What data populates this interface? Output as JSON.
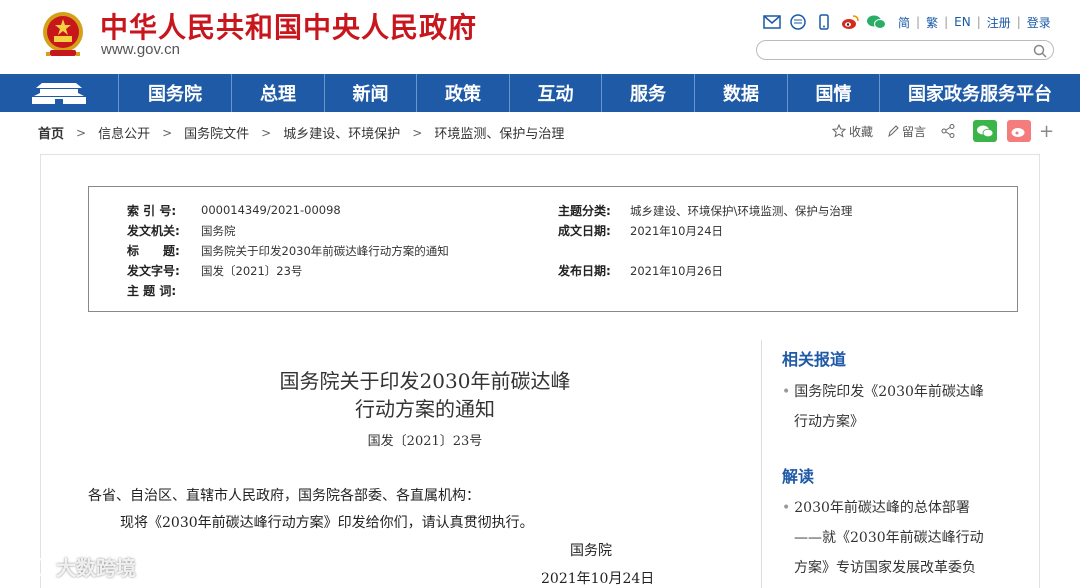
{
  "header": {
    "title": "中华人民共和国中央人民政府",
    "url": "www.gov.cn",
    "lang_links": [
      "简",
      "繁",
      "EN",
      "注册",
      "登录"
    ],
    "tool_icons": [
      "mail-icon",
      "message-icon",
      "mobile-icon",
      "weibo-icon",
      "wechat-icon"
    ],
    "search_placeholder": ""
  },
  "nav": {
    "items": [
      "国务院",
      "总理",
      "新闻",
      "政策",
      "互动",
      "服务",
      "数据",
      "国情",
      "国家政务服务平台"
    ]
  },
  "breadcrumb": {
    "items": [
      "首页",
      "信息公开",
      "国务院文件",
      "城乡建设、环境保护",
      "环境监测、保护与治理"
    ]
  },
  "actions": {
    "favorite": "收藏",
    "comment": "留言"
  },
  "meta": {
    "index_key": "索 引 号:",
    "index_val": "000014349/2021-00098",
    "org_key": "发文机关:",
    "org_val": "国务院",
    "title_key": "标　　题:",
    "title_val": "国务院关于印发2030年前碳达峰行动方案的通知",
    "docnum_key": "发文字号:",
    "docnum_val": "国发〔2021〕23号",
    "subject_key": "主 题 词:",
    "subject_val": "",
    "category_key": "主题分类:",
    "category_val": "城乡建设、环境保护\\环境监测、保护与治理",
    "created_key": "成文日期:",
    "created_val": "2021年10月24日",
    "published_key": "发布日期:",
    "published_val": "2021年10月26日"
  },
  "doc": {
    "title_line1": "国务院关于印发2030年前碳达峰",
    "title_line2": "行动方案的通知",
    "number": "国发〔2021〕23号",
    "salutation": "各省、自治区、直辖市人民政府，国务院各部委、各直属机构：",
    "body": "现将《2030年前碳达峰行动方案》印发给你们，请认真贯彻执行。",
    "signer": "国务院",
    "date": "2021年10月24日"
  },
  "sidebar": {
    "related_heading": "相关报道",
    "related_line1": "国务院印发《2030年前碳达峰",
    "related_line2": "行动方案》",
    "interpret_heading": "解读",
    "interpret_line1": "2030年前碳达峰的总体部署",
    "interpret_line2": "——就《2030年前碳达峰行动",
    "interpret_line3": "方案》专访国家发展改革委负"
  },
  "watermark": "大数跨境",
  "colors": {
    "brand_red": "#c8161d",
    "nav_blue": "#1f5aa6"
  }
}
